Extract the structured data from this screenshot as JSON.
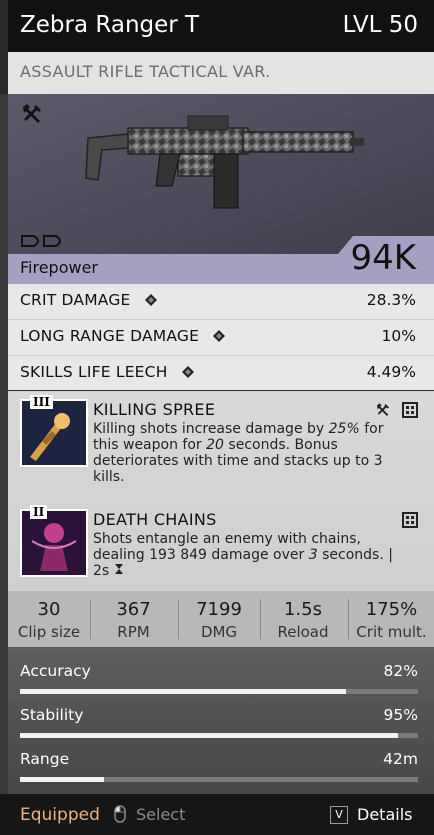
{
  "header": {
    "title": "Zebra Ranger T",
    "level": "LVL 50"
  },
  "subtitle": "ASSAULT RIFLE TACTICAL VAR.",
  "weapon": {
    "image_icon": "rifle-image"
  },
  "firepower": {
    "label": "Firepower",
    "value": "94K"
  },
  "stats": [
    {
      "name": "CRIT DAMAGE",
      "value": "28.3%",
      "icon": "gem-icon"
    },
    {
      "name": "LONG RANGE DAMAGE",
      "value": "10%",
      "icon": "gem-icon"
    },
    {
      "name": "SKILLS LIFE LEECH",
      "value": "4.49%",
      "icon": "gem-icon"
    }
  ],
  "skills": [
    {
      "rank": "III",
      "name": "KILLING SPREE",
      "desc_1": "Killing shots increase damage by ",
      "desc_val_1": "25%",
      "desc_2": " for this weapon for ",
      "desc_val_2": "20",
      "desc_3": " seconds. Bonus deteriorates with time and stacks up to 3 kills."
    },
    {
      "rank": "II",
      "name": "DEATH CHAINS",
      "desc_1": "Shots entangle an enemy with chains, dealing 193 849 damage over ",
      "desc_val_1": "3",
      "desc_2": " seconds. | ",
      "cooldown": "2s"
    }
  ],
  "numbers": [
    {
      "value": "30",
      "label": "Clip size"
    },
    {
      "value": "367",
      "label": "RPM"
    },
    {
      "value": "7199",
      "label": "DMG"
    },
    {
      "value": "1.5s",
      "label": "Reload"
    },
    {
      "value": "175%",
      "label": "Crit mult."
    }
  ],
  "bars": [
    {
      "name": "Accuracy",
      "value": "82%",
      "fill": 0.82
    },
    {
      "name": "Stability",
      "value": "95%",
      "fill": 0.95
    },
    {
      "name": "Range",
      "value": "42m",
      "fill": 0.21
    }
  ],
  "footer": {
    "equipped": "Equipped",
    "select": "Select",
    "key": "V",
    "details": "Details"
  },
  "colors": {
    "header_bg": "#111111",
    "firepower_band": "#a79fc1",
    "equipped": "#e9b28a"
  }
}
